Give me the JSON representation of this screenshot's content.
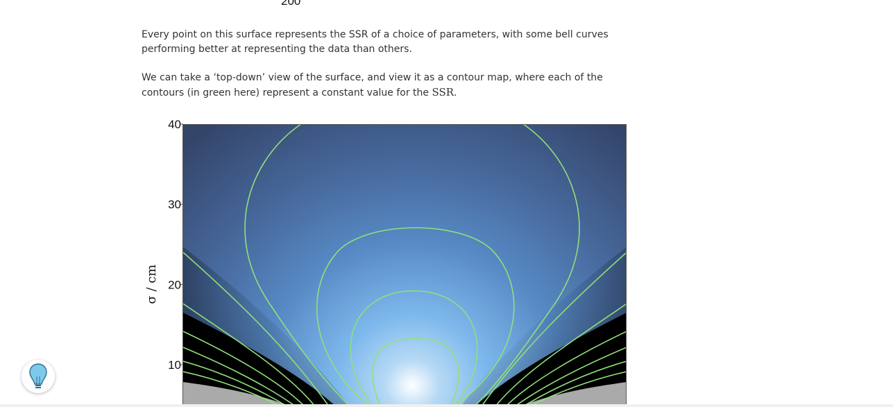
{
  "article": {
    "prev_figure_tick": "200",
    "paragraph_1": "Every point on this surface represents the SSR of a choice of parameters, with some bell curves performing better at representing the data than others.",
    "paragraph_2_before": "We can take a ‘top-down’ view of the surface, and view it as a contour map, where each of the contours (in green here) represent a constant value for the ",
    "paragraph_2_math": "SSR",
    "paragraph_2_after": "."
  },
  "help_widget": {
    "icon": "lightbulb-icon",
    "color": "#7ec9ea"
  },
  "chart_data": {
    "type": "heatmap",
    "title": "",
    "xlabel": "",
    "ylabel": "σ / cm",
    "y_ticks": [
      "40",
      "30",
      "20",
      "10"
    ],
    "y_tick_values": [
      40,
      30,
      20,
      10
    ],
    "ylim": [
      5,
      40
    ],
    "contour_color": "#90e07a",
    "colormap": [
      "#ffffff",
      "#7db8ec",
      "#4b6fa2",
      "#37496c",
      "#000000"
    ],
    "invalid_region_color": "#aaaaaa",
    "minimum": {
      "sigma": 7.5
    }
  }
}
